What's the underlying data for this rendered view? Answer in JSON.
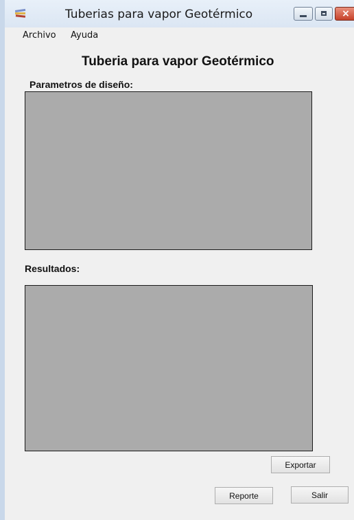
{
  "window": {
    "title": "Tuberias para vapor Geotérmico",
    "controls": {
      "close_glyph": "×"
    }
  },
  "menu": {
    "items": [
      "Archivo",
      "Ayuda"
    ]
  },
  "form": {
    "title": "Tuberia para vapor Geotérmico",
    "design_params_label": "Parametros de diseño:",
    "results_label": "Resultados:"
  },
  "buttons": {
    "export_label": "Exportar",
    "report_label": "Reporte",
    "exit_label": "Salir"
  },
  "colors": {
    "panel_fill": "#ababab",
    "window_bg": "#f0f0f0",
    "close_button": "#c6412a"
  },
  "icons": {
    "app": "stacked-books-icon",
    "minimize": "minimize-icon",
    "maximize": "maximize-icon",
    "close": "close-icon"
  }
}
